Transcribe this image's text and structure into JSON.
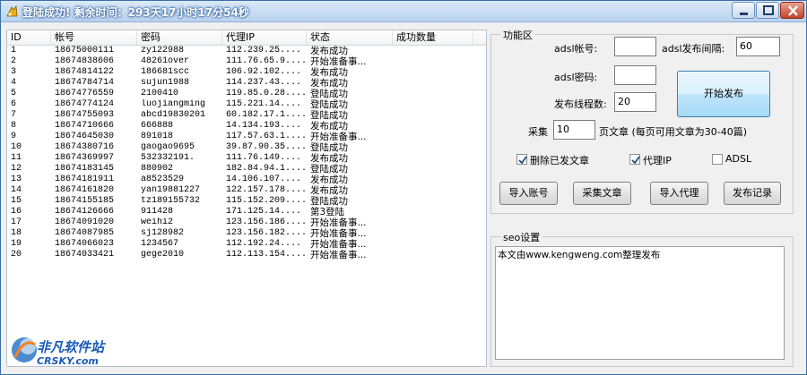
{
  "window": {
    "title": "登陆成功! 剩余时间：293天17小时17分54秒"
  },
  "table": {
    "columns": [
      "ID",
      "帐号",
      "密码",
      "代理IP",
      "状态",
      "成功数量"
    ],
    "rows": [
      {
        "id": "1",
        "account": "18675000111",
        "password": "zy122988",
        "proxy": "112.239.25....",
        "status": "发布成功"
      },
      {
        "id": "2",
        "account": "18674838606",
        "password": "48261over",
        "proxy": "111.76.65.9....",
        "status": "开始准备事..."
      },
      {
        "id": "3",
        "account": "18674814122",
        "password": "186681scc",
        "proxy": "106.92.102....",
        "status": "发布成功"
      },
      {
        "id": "4",
        "account": "18674784714",
        "password": "sujun1988",
        "proxy": "114.237.43....",
        "status": "发布成功"
      },
      {
        "id": "5",
        "account": "18674776559",
        "password": "2100410",
        "proxy": "119.85.0.28....",
        "status": "登陆成功"
      },
      {
        "id": "6",
        "account": "18674774124",
        "password": "luojiangming",
        "proxy": "115.221.14....",
        "status": "登陆成功"
      },
      {
        "id": "7",
        "account": "18674755093",
        "password": "abcd19830201",
        "proxy": "60.182.17.1....",
        "status": "登陆成功"
      },
      {
        "id": "8",
        "account": "18674710666",
        "password": "666888",
        "proxy": "14.134.193....",
        "status": "发布成功"
      },
      {
        "id": "9",
        "account": "18674645030",
        "password": "891018",
        "proxy": "117.57.63.1....",
        "status": "开始准备事..."
      },
      {
        "id": "10",
        "account": "18674380716",
        "password": "gaogao9695",
        "proxy": "39.87.90.35....",
        "status": "登陆成功"
      },
      {
        "id": "11",
        "account": "18674369997",
        "password": "532332191.",
        "proxy": "111.76.149....",
        "status": "发布成功"
      },
      {
        "id": "12",
        "account": "18674183145",
        "password": "880902",
        "proxy": "182.84.94.1....",
        "status": "登陆成功"
      },
      {
        "id": "13",
        "account": "18674181911",
        "password": "a8523529",
        "proxy": "14.106.107....",
        "status": "发布成功"
      },
      {
        "id": "14",
        "account": "18674161820",
        "password": "yan19881227",
        "proxy": "122.157.178....",
        "status": "发布成功"
      },
      {
        "id": "15",
        "account": "18674155185",
        "password": "tz189155732",
        "proxy": "115.152.209....",
        "status": "登陆成功"
      },
      {
        "id": "16",
        "account": "18674126666",
        "password": "911428",
        "proxy": "171.125.14....",
        "status": "第3登陆"
      },
      {
        "id": "17",
        "account": "18674091020",
        "password": "weihi2",
        "proxy": "123.156.186....",
        "status": "开始准备事..."
      },
      {
        "id": "18",
        "account": "18674087985",
        "password": "sj128982",
        "proxy": "123.156.182....",
        "status": "开始准备事..."
      },
      {
        "id": "19",
        "account": "18674066023",
        "password": "1234567",
        "proxy": "112.192.24....",
        "status": "开始准备事..."
      },
      {
        "id": "20",
        "account": "18674033421",
        "password": "gege2010",
        "proxy": "112.113.154....",
        "status": "开始准备事..."
      }
    ]
  },
  "function_area": {
    "title": "功能区",
    "adsl_account_label": "adsl帐号:",
    "adsl_account_value": "",
    "adsl_interval_label": "adsl发布间隔:",
    "adsl_interval_value": "60",
    "adsl_password_label": "adsl密码:",
    "adsl_password_value": "",
    "threads_label": "发布线程数:",
    "threads_value": "20",
    "start_button": "开始发布",
    "collect_label": "采集",
    "collect_pages_value": "10",
    "collect_suffix": "页文章 (每页可用文章为30-40篇)",
    "checkbox_delete_label": "删除已发文章",
    "checkbox_delete_checked": true,
    "checkbox_proxy_label": "代理IP",
    "checkbox_proxy_checked": true,
    "checkbox_adsl_label": "ADSL",
    "checkbox_adsl_checked": false,
    "buttons": [
      "导入账号",
      "采集文章",
      "导入代理",
      "发布记录"
    ]
  },
  "seo": {
    "title": "seo设置",
    "content": "本文由www.kengweng.com整理发布"
  },
  "watermark": {
    "brand": "非凡软件站",
    "sub": "CRSKY.com"
  }
}
